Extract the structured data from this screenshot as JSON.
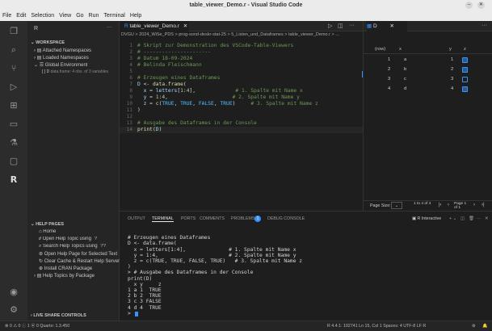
{
  "window": {
    "title": "table_viewer_Demo.r - Visual Studio Code",
    "minimize": "–",
    "close": "✕"
  },
  "menu": [
    "File",
    "Edit",
    "Selection",
    "View",
    "Go",
    "Run",
    "Terminal",
    "Help"
  ],
  "sidebar": {
    "header": "R",
    "more": "···",
    "workspace_label": "WORKSPACE",
    "items": [
      "Attached Namespaces",
      "Loaded Namespaces",
      "Global Environment"
    ],
    "dataframe": {
      "name": "D",
      "desc": "data.frame: 4 obs. of 3 variables"
    },
    "help_label": "HELP PAGES",
    "help_items": [
      "Home",
      "Open Help Topic using `?`",
      "Search Help Topics using `??`",
      "Open Help Page for Selected Text",
      "Clear Cache & Restart Help Server",
      "Install CRAN Package",
      "Help Topics by Package"
    ],
    "live_share": "LIVE SHARE CONTROLS"
  },
  "editor": {
    "tab_label": "table_viewer_Demo.r",
    "breadcrumb": "DVGU > 2024_WiSe_PDS > prog-sond-deskr-stat-25 > 5_Listen_und_Dataframes > table_viewer_Demo.r > ...",
    "lines": [
      {
        "n": "1",
        "segs": [
          {
            "c": "cm",
            "t": "# Skript zur Demonstration des VSCode-Table-Viewers"
          }
        ]
      },
      {
        "n": "2",
        "segs": [
          {
            "c": "cm",
            "t": "# ----------------------"
          }
        ]
      },
      {
        "n": "3",
        "segs": [
          {
            "c": "cm",
            "t": "# Datum 18-09-2024"
          }
        ]
      },
      {
        "n": "4",
        "segs": [
          {
            "c": "cm",
            "t": "# Belinda Fleischmann"
          }
        ]
      },
      {
        "n": "5",
        "segs": []
      },
      {
        "n": "6",
        "segs": [
          {
            "c": "cm",
            "t": "# Erzeugen eines Dataframes"
          }
        ]
      },
      {
        "n": "7",
        "segs": [
          {
            "c": "id",
            "t": "D "
          },
          {
            "c": "op",
            "t": "<- "
          },
          {
            "c": "fn",
            "t": "data.frame"
          },
          {
            "c": "op",
            "t": "("
          }
        ]
      },
      {
        "n": "8",
        "segs": [
          {
            "c": "id",
            "t": "  x "
          },
          {
            "c": "op",
            "t": "= "
          },
          {
            "c": "id",
            "t": "letters"
          },
          {
            "c": "op",
            "t": "["
          },
          {
            "c": "nm",
            "t": "1"
          },
          {
            "c": "op",
            "t": ":"
          },
          {
            "c": "nm",
            "t": "4"
          },
          {
            "c": "op",
            "t": "],             "
          },
          {
            "c": "cm",
            "t": "# 1. Spalte mit Name x"
          }
        ]
      },
      {
        "n": "9",
        "segs": [
          {
            "c": "id",
            "t": "  y "
          },
          {
            "c": "op",
            "t": "= "
          },
          {
            "c": "nm",
            "t": "1"
          },
          {
            "c": "op",
            "t": ":"
          },
          {
            "c": "nm",
            "t": "4"
          },
          {
            "c": "op",
            "t": ",                     "
          },
          {
            "c": "cm",
            "t": "# 2. Spalte mit Name y"
          }
        ]
      },
      {
        "n": "10",
        "segs": [
          {
            "c": "id",
            "t": "  z "
          },
          {
            "c": "op",
            "t": "= "
          },
          {
            "c": "fn",
            "t": "c"
          },
          {
            "c": "op",
            "t": "("
          },
          {
            "c": "cs",
            "t": "TRUE"
          },
          {
            "c": "op",
            "t": ", "
          },
          {
            "c": "cs",
            "t": "TRUE"
          },
          {
            "c": "op",
            "t": ", "
          },
          {
            "c": "cs",
            "t": "FALSE"
          },
          {
            "c": "op",
            "t": ", "
          },
          {
            "c": "cs",
            "t": "TRUE"
          },
          {
            "c": "op",
            "t": ")     "
          },
          {
            "c": "cm",
            "t": "# 3. Spalte mit Name z"
          }
        ]
      },
      {
        "n": "11",
        "segs": [
          {
            "c": "op",
            "t": ")"
          }
        ]
      },
      {
        "n": "12",
        "segs": []
      },
      {
        "n": "13",
        "segs": [
          {
            "c": "cm",
            "t": "# Ausgabe des Dataframes in der Console"
          }
        ]
      },
      {
        "n": "14",
        "segs": [
          {
            "c": "fn",
            "t": "print"
          },
          {
            "c": "op",
            "t": "("
          },
          {
            "c": "id",
            "t": "D"
          },
          {
            "c": "op",
            "t": ")"
          }
        ]
      }
    ]
  },
  "viewer": {
    "tab_label": "D",
    "headers": [
      "(row)",
      "x",
      "y",
      "z"
    ],
    "rows": [
      {
        "row": "1",
        "x": "a",
        "y": "1",
        "z": true
      },
      {
        "row": "2",
        "x": "b",
        "y": "2",
        "z": true
      },
      {
        "row": "3",
        "x": "c",
        "y": "3",
        "z": false
      },
      {
        "row": "4",
        "x": "d",
        "y": "4",
        "z": true
      }
    ],
    "page_size_label": "Page Size:",
    "range": "1 to 4 of 4",
    "page": "Page 1 of 1"
  },
  "panel": {
    "tabs": [
      "OUTPUT",
      "TERMINAL",
      "PORTS",
      "COMMENTS",
      "PROBLEMS",
      "DEBUG CONSOLE"
    ],
    "problems_count": "1",
    "terminal_name": "R Interactive",
    "terminal_lines": [
      "",
      "# Erzeugen eines Dataframes",
      "D <- data.frame(",
      "  x = letters[1:4],              # 1. Spalte mit Name x",
      "  y = 1:4,                       # 2. Spalte mit Name y",
      "  z = c(TRUE, TRUE, FALSE, TRUE)   # 3. Spalte mit Name z",
      ")",
      "> # Ausgabe des Dataframes in der Console",
      "print(D)",
      "  x y     z",
      "1 a 1  TRUE",
      "2 b 2  TRUE",
      "3 c 3 FALSE",
      "4 d 4  TRUE",
      "> "
    ]
  },
  "status": {
    "left": "⊗ 0 ⚠ 0 ⓘ 1   ⦿ 0   Quarto: 1.3.450",
    "right": "R 4.4.1: 102741   Ln 15, Col 1   Spaces: 4   UTF-8   LF   R"
  },
  "colors": {
    "accent": "#3794ff",
    "comment": "#6a9955",
    "keyword": "#569cd6"
  }
}
